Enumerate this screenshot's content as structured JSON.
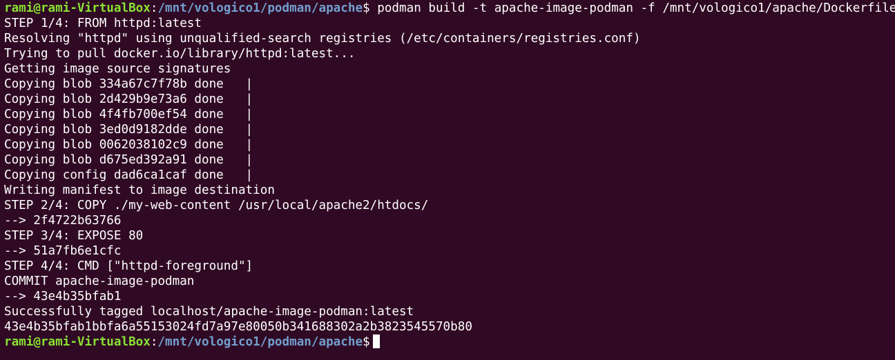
{
  "prompt": {
    "user_host": "rami@rami-VirtualBox",
    "separator": ":",
    "cwd": "/mnt/vologico1/podman/apache",
    "symbol": "$"
  },
  "command": " podman build -t apache-image-podman -f /mnt/vologico1/apache/Dockerfile",
  "output_lines": [
    "STEP 1/4: FROM httpd:latest",
    "Resolving \"httpd\" using unqualified-search registries (/etc/containers/registries.conf)",
    "Trying to pull docker.io/library/httpd:latest...",
    "Getting image source signatures",
    "Copying blob 334a67c7f78b done   |",
    "Copying blob 2d429b9e73a6 done   |",
    "Copying blob 4f4fb700ef54 done   |",
    "Copying blob 3ed0d9182dde done   |",
    "Copying blob 0062038102c9 done   |",
    "Copying blob d675ed392a91 done   |",
    "Copying config dad6ca1caf done   |",
    "Writing manifest to image destination",
    "STEP 2/4: COPY ./my-web-content /usr/local/apache2/htdocs/",
    "--> 2f4722b63766",
    "STEP 3/4: EXPOSE 80",
    "--> 51a7fb6e1cfc",
    "STEP 4/4: CMD [\"httpd-foreground\"]",
    "COMMIT apache-image-podman",
    "--> 43e4b35bfab1",
    "Successfully tagged localhost/apache-image-podman:latest",
    "43e4b35bfab1bbfa6a55153024fd7a97e80050b341688302a2b3823545570b80"
  ],
  "colors": {
    "background": "#300a24",
    "user_host": "#8ae234",
    "path": "#729fcf",
    "text": "#ffffff"
  }
}
